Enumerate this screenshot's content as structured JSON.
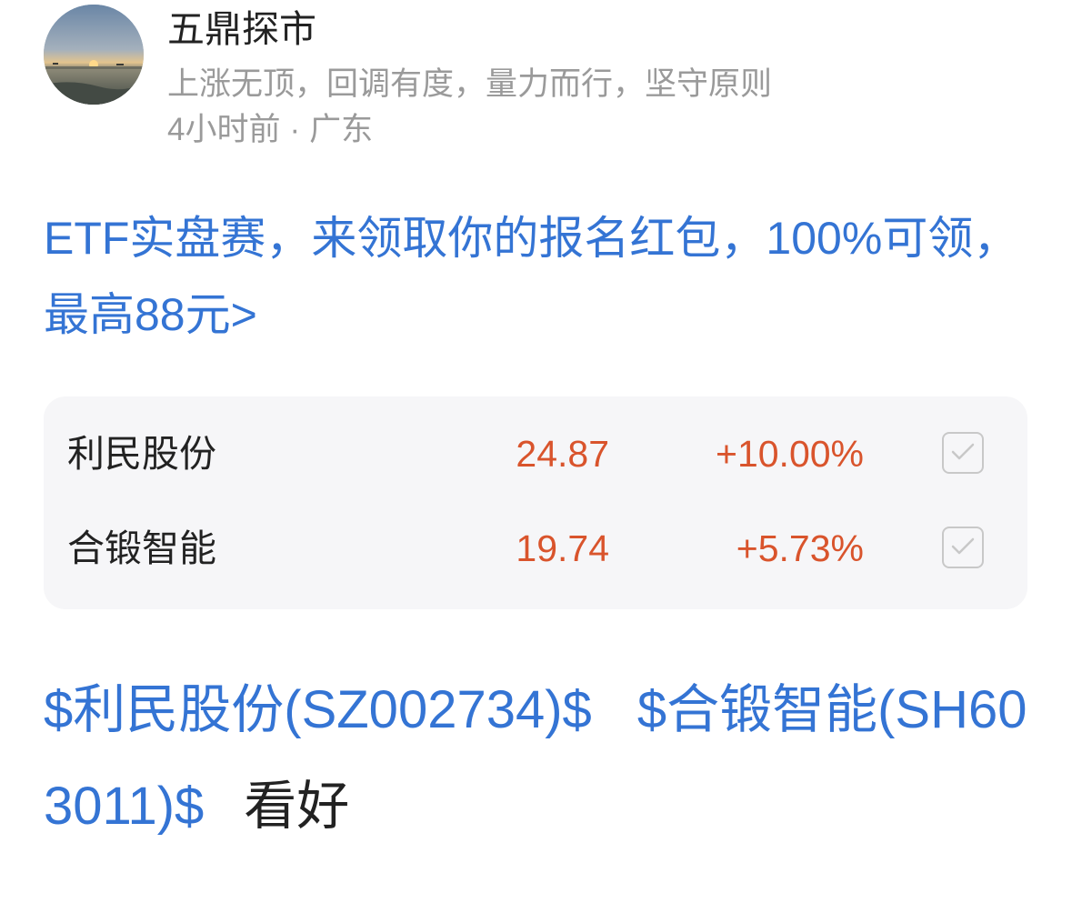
{
  "author": {
    "name": "五鼎探市",
    "bio": "上涨无顶，回调有度，量力而行，坚守原则",
    "time": "4小时前",
    "separator": "·",
    "location": "广东"
  },
  "promo": {
    "text": "ETF实盘赛，来领取你的报名红包，100%可领，最高88元>"
  },
  "stocks": [
    {
      "name": "利民股份",
      "price": "24.87",
      "change": "+10.00%"
    },
    {
      "name": "合锻智能",
      "price": "19.74",
      "change": "+5.73%"
    }
  ],
  "post": {
    "tag1": "$利民股份(SZ002734)$",
    "tag2": "$合锻智能(SH603011)$",
    "text": "看好"
  },
  "colors": {
    "link": "#3474d4",
    "up": "#d9542c",
    "muted": "#9a9a9a",
    "card_bg": "#f6f6f8"
  },
  "icons": {
    "avatar": "sunset-photo-avatar",
    "checkbox": "check-icon"
  }
}
